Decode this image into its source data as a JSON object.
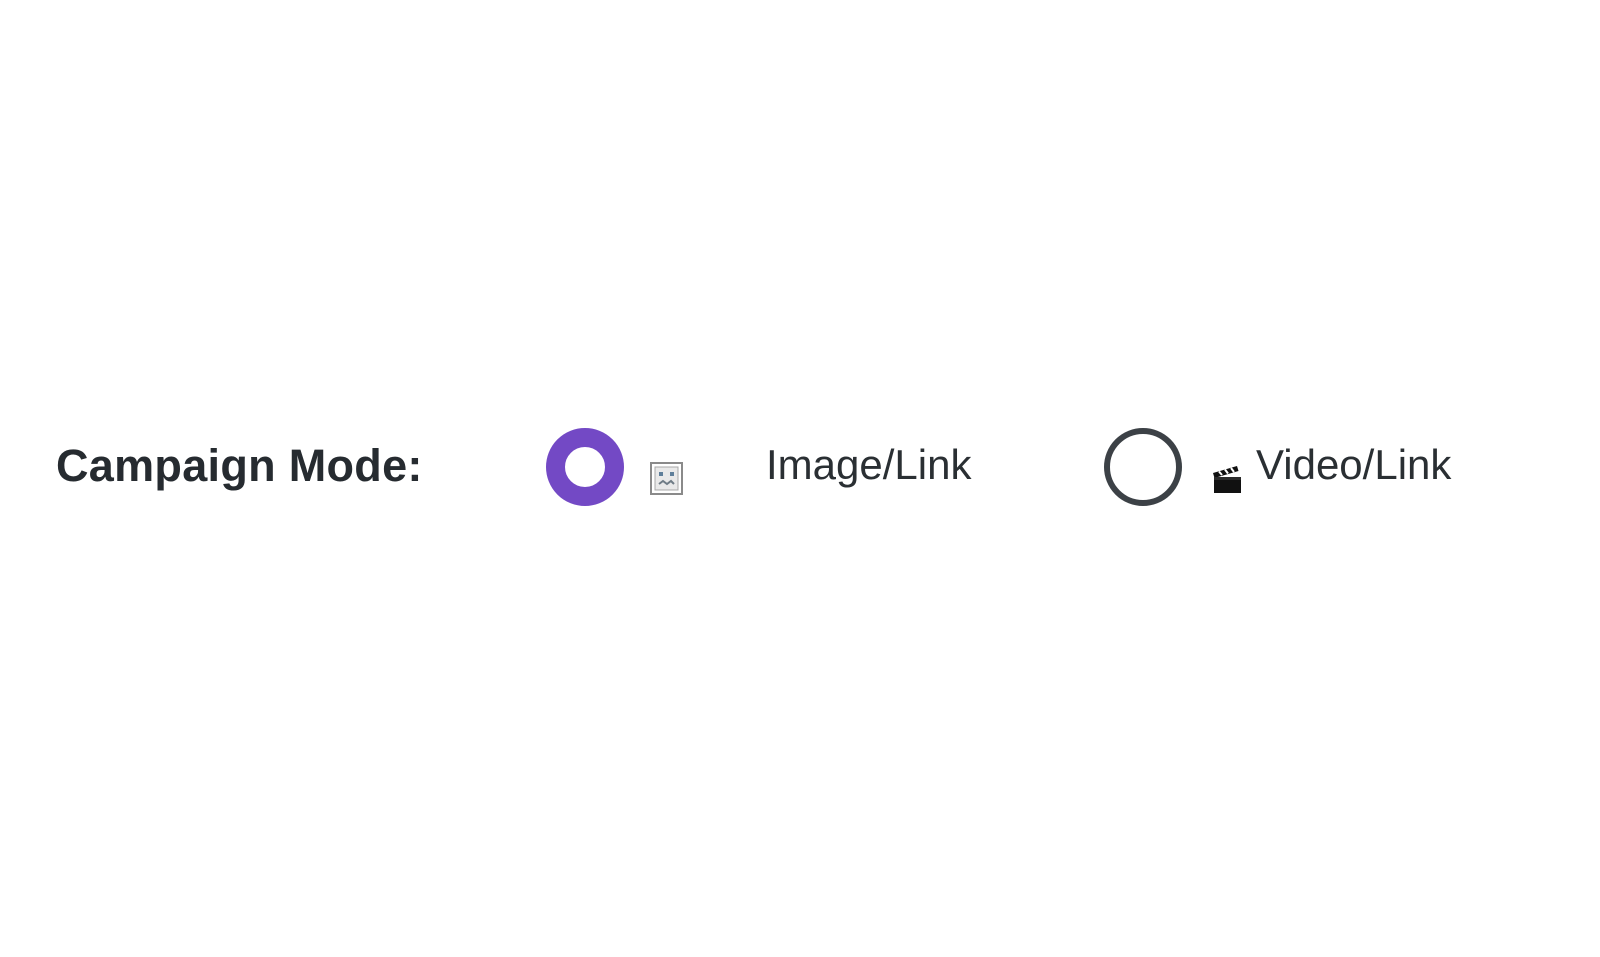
{
  "campaign_mode": {
    "label": "Campaign Mode:",
    "selected": "image_link",
    "accent_color": "#7349c5",
    "options": [
      {
        "id": "image_link",
        "label": "Image/Link",
        "icon": "broken-image-icon",
        "checked": true
      },
      {
        "id": "video_link",
        "label": "Video/Link",
        "icon": "clapper-board-icon",
        "checked": false
      }
    ]
  }
}
